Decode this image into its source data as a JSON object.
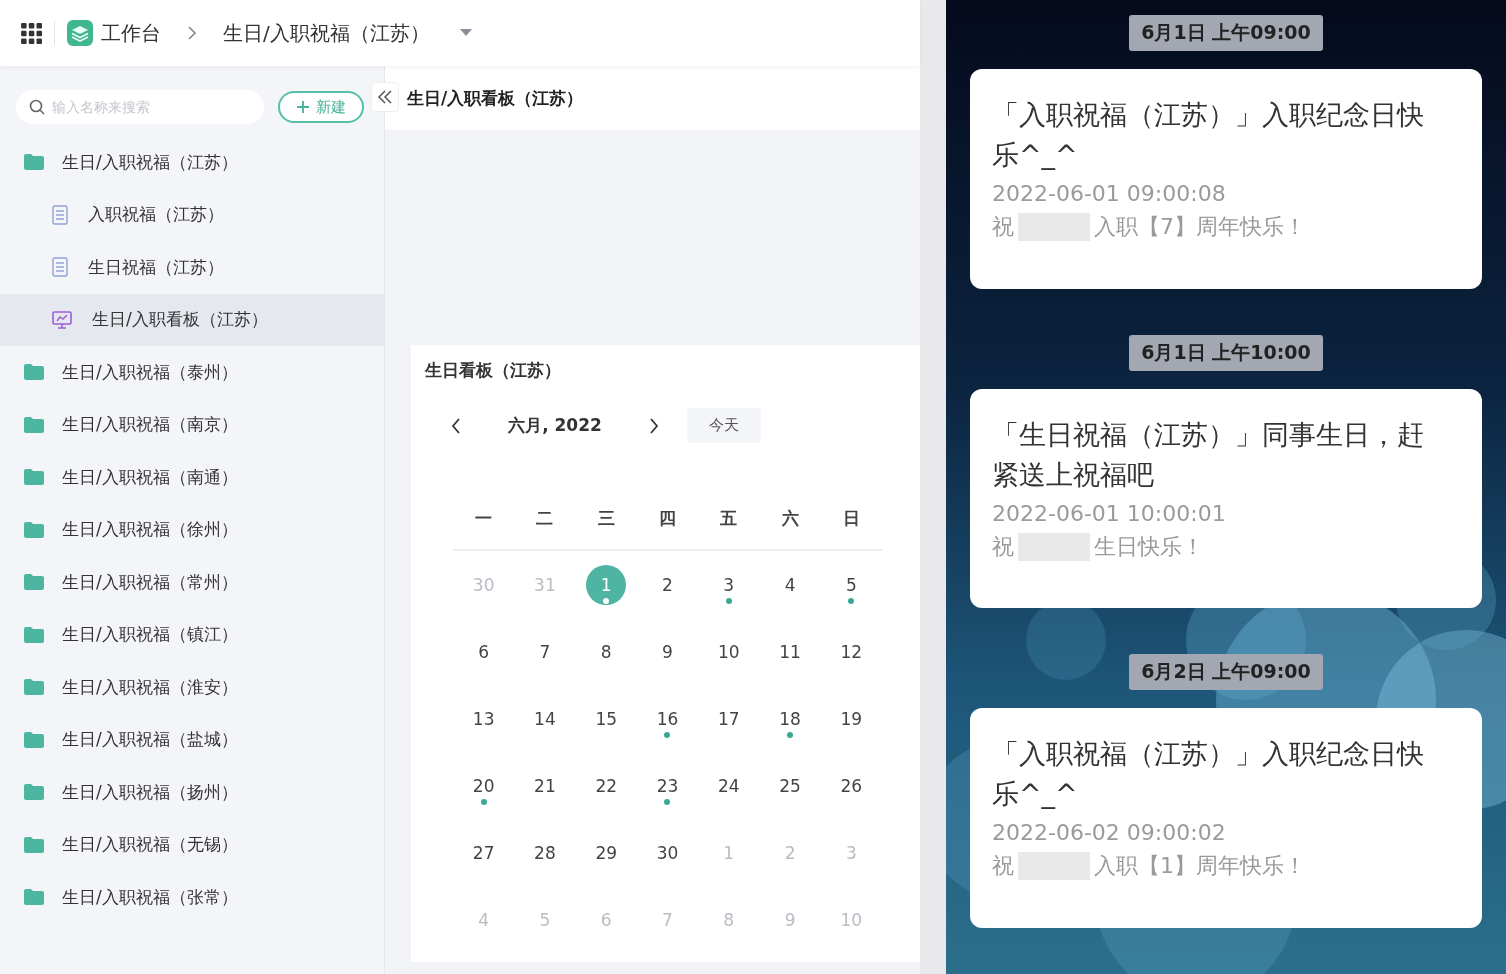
{
  "topbar": {
    "home": "工作台",
    "breadcrumb": "生日/入职祝福（江苏）"
  },
  "sidebar": {
    "search": {
      "placeholder": "输入名称来搜索"
    },
    "new_button": "新建",
    "items": [
      {
        "kind": "folder",
        "label": "生日/入职祝福（江苏）",
        "selected": false,
        "children": [
          {
            "kind": "form",
            "label": "入职祝福（江苏）",
            "selected": false
          },
          {
            "kind": "form",
            "label": "生日祝福（江苏）",
            "selected": false
          },
          {
            "kind": "board",
            "label": "生日/入职看板（江苏）",
            "selected": true
          }
        ]
      },
      {
        "kind": "folder",
        "label": "生日/入职祝福（泰州）",
        "selected": false
      },
      {
        "kind": "folder",
        "label": "生日/入职祝福（南京）",
        "selected": false
      },
      {
        "kind": "folder",
        "label": "生日/入职祝福（南通）",
        "selected": false
      },
      {
        "kind": "folder",
        "label": "生日/入职祝福（徐州）",
        "selected": false
      },
      {
        "kind": "folder",
        "label": "生日/入职祝福（常州）",
        "selected": false
      },
      {
        "kind": "folder",
        "label": "生日/入职祝福（镇江）",
        "selected": false
      },
      {
        "kind": "folder",
        "label": "生日/入职祝福（淮安）",
        "selected": false
      },
      {
        "kind": "folder",
        "label": "生日/入职祝福（盐城）",
        "selected": false
      },
      {
        "kind": "folder",
        "label": "生日/入职祝福（扬州）",
        "selected": false
      },
      {
        "kind": "folder",
        "label": "生日/入职祝福（无锡）",
        "selected": false
      },
      {
        "kind": "folder",
        "label": "生日/入职祝福（张常）",
        "selected": false
      }
    ]
  },
  "page": {
    "title": "生日/入职看板（江苏）"
  },
  "calendar": {
    "title": "生日看板（江苏）",
    "month": "六月, 2022",
    "today_button": "今天",
    "weekdays": [
      "一",
      "二",
      "三",
      "四",
      "五",
      "六",
      "日"
    ],
    "weeks": [
      [
        {
          "day": "30",
          "muted": true,
          "selected": false,
          "event": false
        },
        {
          "day": "31",
          "muted": true,
          "selected": false,
          "event": false
        },
        {
          "day": "1",
          "muted": false,
          "selected": true,
          "event": true
        },
        {
          "day": "2",
          "muted": false,
          "selected": false,
          "event": false
        },
        {
          "day": "3",
          "muted": false,
          "selected": false,
          "event": true
        },
        {
          "day": "4",
          "muted": false,
          "selected": false,
          "event": false
        },
        {
          "day": "5",
          "muted": false,
          "selected": false,
          "event": true
        }
      ],
      [
        {
          "day": "6",
          "muted": false,
          "selected": false,
          "event": false
        },
        {
          "day": "7",
          "muted": false,
          "selected": false,
          "event": false
        },
        {
          "day": "8",
          "muted": false,
          "selected": false,
          "event": false
        },
        {
          "day": "9",
          "muted": false,
          "selected": false,
          "event": false
        },
        {
          "day": "10",
          "muted": false,
          "selected": false,
          "event": false
        },
        {
          "day": "11",
          "muted": false,
          "selected": false,
          "event": false
        },
        {
          "day": "12",
          "muted": false,
          "selected": false,
          "event": false
        }
      ],
      [
        {
          "day": "13",
          "muted": false,
          "selected": false,
          "event": false
        },
        {
          "day": "14",
          "muted": false,
          "selected": false,
          "event": false
        },
        {
          "day": "15",
          "muted": false,
          "selected": false,
          "event": false
        },
        {
          "day": "16",
          "muted": false,
          "selected": false,
          "event": true
        },
        {
          "day": "17",
          "muted": false,
          "selected": false,
          "event": false
        },
        {
          "day": "18",
          "muted": false,
          "selected": false,
          "event": true
        },
        {
          "day": "19",
          "muted": false,
          "selected": false,
          "event": false
        }
      ],
      [
        {
          "day": "20",
          "muted": false,
          "selected": false,
          "event": true
        },
        {
          "day": "21",
          "muted": false,
          "selected": false,
          "event": false
        },
        {
          "day": "22",
          "muted": false,
          "selected": false,
          "event": false
        },
        {
          "day": "23",
          "muted": false,
          "selected": false,
          "event": true
        },
        {
          "day": "24",
          "muted": false,
          "selected": false,
          "event": false
        },
        {
          "day": "25",
          "muted": false,
          "selected": false,
          "event": false
        },
        {
          "day": "26",
          "muted": false,
          "selected": false,
          "event": false
        }
      ],
      [
        {
          "day": "27",
          "muted": false,
          "selected": false,
          "event": false
        },
        {
          "day": "28",
          "muted": false,
          "selected": false,
          "event": false
        },
        {
          "day": "29",
          "muted": false,
          "selected": false,
          "event": false
        },
        {
          "day": "30",
          "muted": false,
          "selected": false,
          "event": false
        },
        {
          "day": "1",
          "muted": true,
          "selected": false,
          "event": false
        },
        {
          "day": "2",
          "muted": true,
          "selected": false,
          "event": false
        },
        {
          "day": "3",
          "muted": true,
          "selected": false,
          "event": false
        }
      ],
      [
        {
          "day": "4",
          "muted": true,
          "selected": false,
          "event": false
        },
        {
          "day": "5",
          "muted": true,
          "selected": false,
          "event": false
        },
        {
          "day": "6",
          "muted": true,
          "selected": false,
          "event": false
        },
        {
          "day": "7",
          "muted": true,
          "selected": false,
          "event": false
        },
        {
          "day": "8",
          "muted": true,
          "selected": false,
          "event": false
        },
        {
          "day": "9",
          "muted": true,
          "selected": false,
          "event": false
        },
        {
          "day": "10",
          "muted": true,
          "selected": false,
          "event": false
        }
      ]
    ]
  },
  "notifications": [
    {
      "time": "6月1日 上午09:00",
      "title": "「入职祝福（江苏）」入职纪念日快乐^_^",
      "timestamp": "2022-06-01 09:00:08",
      "greeting": "祝",
      "message": "入职【7】周年快乐！"
    },
    {
      "time": "6月1日 上午10:00",
      "title": "「生日祝福（江苏）」同事生日，赶紧送上祝福吧",
      "timestamp": "2022-06-01 10:00:01",
      "greeting": "祝",
      "message": "生日快乐！"
    },
    {
      "time": "6月2日 上午09:00",
      "title": "「入职祝福（江苏）」入职纪念日快乐^_^",
      "timestamp": "2022-06-02 09:00:02",
      "greeting": "祝",
      "message": "入职【1】周年快乐！"
    }
  ]
}
